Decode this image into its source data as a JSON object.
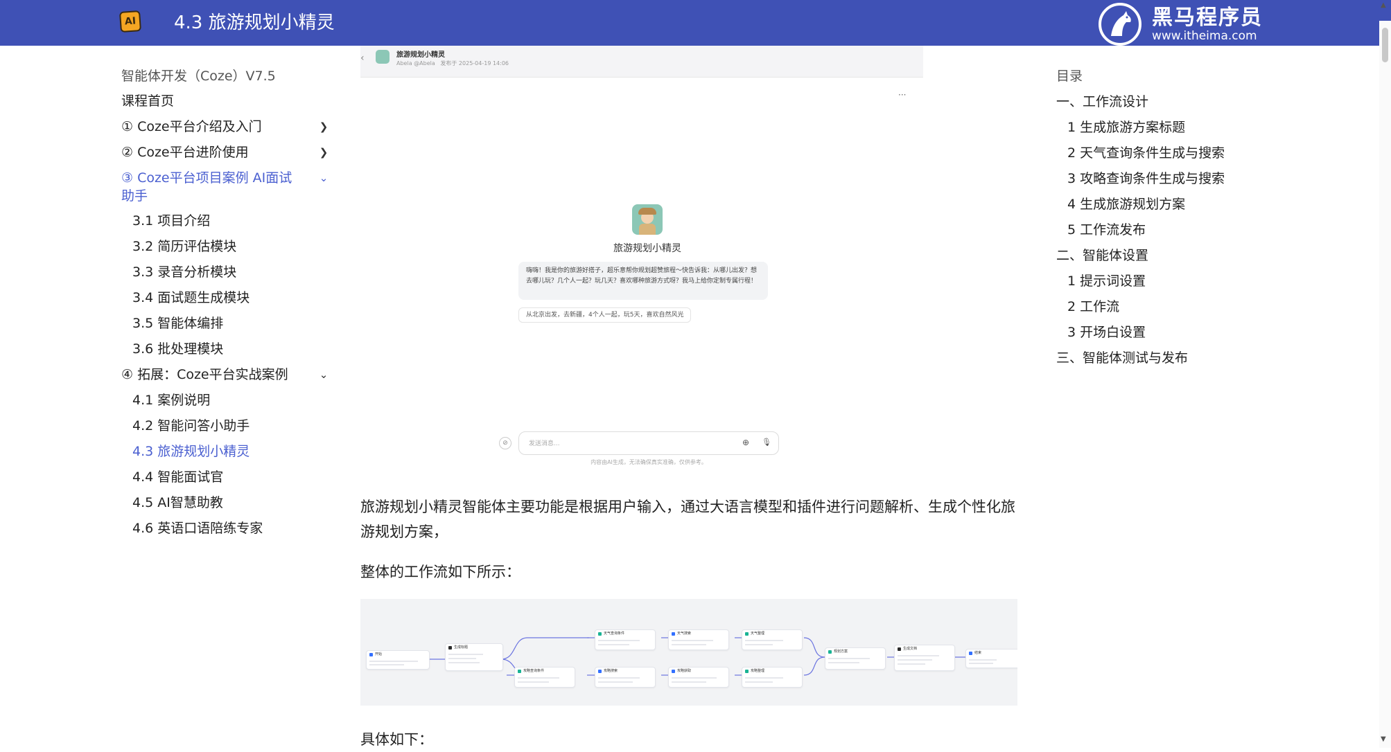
{
  "header": {
    "logo_text": "AI",
    "title": "4.3 旅游规划小精灵",
    "brand_cn": "黑马程序员",
    "brand_en": "www.itheima.com"
  },
  "sidebar": {
    "heading": "智能体开发（Coze）V7.5",
    "items": [
      {
        "label": "课程首页",
        "level": 1,
        "chevron": ""
      },
      {
        "label": "① Coze平台介绍及入门",
        "level": 1,
        "chevron": "right"
      },
      {
        "label": "② Coze平台进阶使用",
        "level": 1,
        "chevron": "right"
      },
      {
        "label": "③ Coze平台项目案例 AI面试助手",
        "level": 1,
        "chevron": "down",
        "expanded": true
      },
      {
        "label": "3.1 项目介绍",
        "level": 2
      },
      {
        "label": "3.2 简历评估模块",
        "level": 2
      },
      {
        "label": "3.3 录音分析模块",
        "level": 2
      },
      {
        "label": "3.4 面试题生成模块",
        "level": 2
      },
      {
        "label": "3.5 智能体编排",
        "level": 2
      },
      {
        "label": "3.6 批处理模块",
        "level": 2
      },
      {
        "label": "④ 拓展：Coze平台实战案例",
        "level": 1,
        "chevron": "down",
        "expanded": true
      },
      {
        "label": "4.1 案例说明",
        "level": 2
      },
      {
        "label": "4.2 智能问答小助手",
        "level": 2
      },
      {
        "label": "4.3 旅游规划小精灵",
        "level": 2,
        "active": true
      },
      {
        "label": "4.4 智能面试官",
        "level": 2
      },
      {
        "label": "4.5 AI智慧助教",
        "level": 2
      },
      {
        "label": "4.6 英语口语陪练专家",
        "level": 2
      }
    ]
  },
  "toc": {
    "title": "目录",
    "items": [
      {
        "label": "一、工作流设计",
        "level": 1
      },
      {
        "label": "1 生成旅游方案标题",
        "level": 2
      },
      {
        "label": "2 天气查询条件生成与搜索",
        "level": 2
      },
      {
        "label": "3 攻略查询条件生成与搜索",
        "level": 2
      },
      {
        "label": "4 生成旅游规划方案",
        "level": 2
      },
      {
        "label": "5 工作流发布",
        "level": 2
      },
      {
        "label": "二、智能体设置",
        "level": 1
      },
      {
        "label": "1 提示词设置",
        "level": 2
      },
      {
        "label": "2 工作流",
        "level": 2
      },
      {
        "label": "3 开场白设置",
        "level": 2
      },
      {
        "label": "三、智能体测试与发布",
        "level": 1
      }
    ]
  },
  "screenshot": {
    "bot_name": "旅游规划小精灵",
    "author": "Abela @Abela",
    "published": "发布于 2025-04-19 14:06",
    "greeting": "嗨嗨！我是你的旅游好搭子，超乐意帮你规划超赞旅程～快告诉我：从哪儿出发？想去哪儿玩？几个人一起？玩几天？喜欢哪种旅游方式呀？我马上给你定制专属行程！",
    "suggestion": "从北京出发，去新疆，4个人一起，玩5天，喜欢自然风光",
    "input_placeholder": "发送消息...",
    "disclaimer": "内容由AI生成，无法确保真实准确，仅供参考。"
  },
  "content": {
    "paragraph_1": "旅游规划小精灵智能体主要功能是根据用户输入，通过大语言模型和插件进行问题解析、生成个性化旅游规划方案，",
    "paragraph_2": "整体的工作流如下所示：",
    "paragraph_3": "具体如下："
  },
  "workflow_nodes": [
    {
      "id": "start",
      "label": "开始",
      "color": "#3370ff"
    },
    {
      "id": "title",
      "label": "生成标题",
      "color": "#2b2b2b"
    },
    {
      "id": "weather_cond",
      "label": "天气查询条件",
      "color": "#1ab394"
    },
    {
      "id": "weather_search",
      "label": "天气搜索",
      "color": "#3370ff"
    },
    {
      "id": "weather_merge",
      "label": "天气整理",
      "color": "#1ab394"
    },
    {
      "id": "guide_cond",
      "label": "攻略查询条件",
      "color": "#1ab394"
    },
    {
      "id": "guide_search",
      "label": "攻略搜索",
      "color": "#3370ff"
    },
    {
      "id": "guide_search2",
      "label": "攻略获取",
      "color": "#3370ff"
    },
    {
      "id": "guide_merge",
      "label": "攻略整理",
      "color": "#1ab394"
    },
    {
      "id": "plan",
      "label": "规划方案",
      "color": "#1ab394"
    },
    {
      "id": "output",
      "label": "生成文档",
      "color": "#2b2b2b"
    },
    {
      "id": "end",
      "label": "结束",
      "color": "#3370ff"
    }
  ],
  "colors": {
    "header_bg": "#3f51b5",
    "active_link": "#4a5fd0"
  }
}
